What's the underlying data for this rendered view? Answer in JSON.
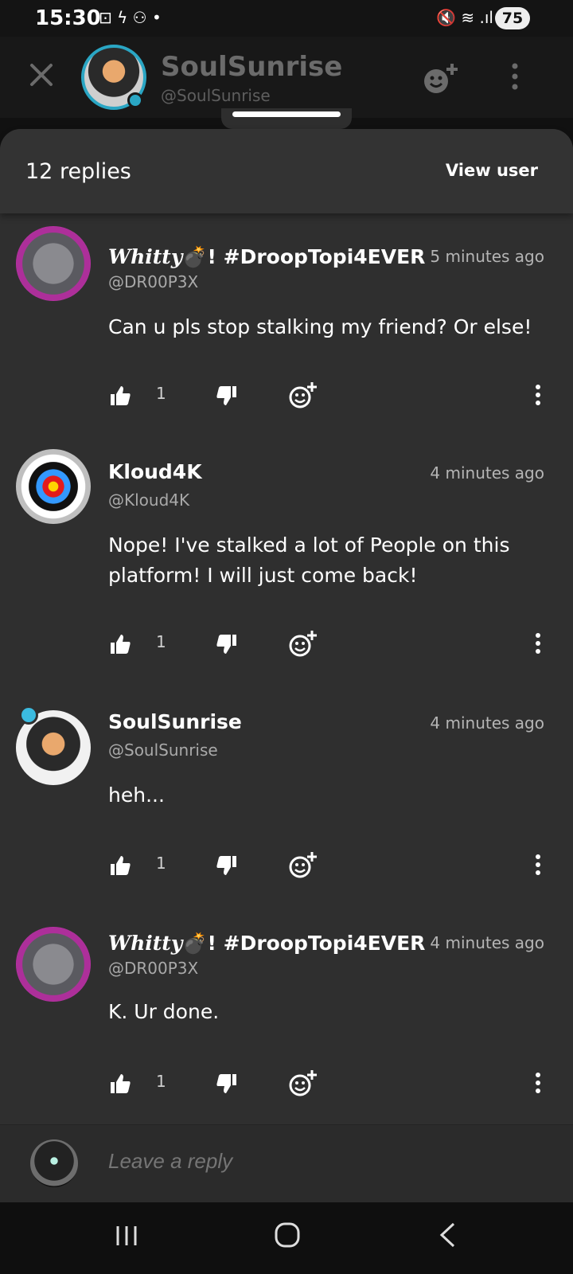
{
  "status_bar": {
    "time": "15:30",
    "left_icons": "⊡ ϟ ⚇ •",
    "right_icons": "🔇 ≋ .ıl",
    "battery": "75"
  },
  "profile_header": {
    "name": "SoulSunrise",
    "handle": "@SoulSunrise"
  },
  "sheet": {
    "replies_count": "12 replies",
    "view_user": "View user"
  },
  "comments": [
    {
      "name_script": "Whitty",
      "name_emoji": "💣",
      "name_rest": "! #DroopTopi4EVER",
      "handle": "@DR00P3X",
      "time": "5 minutes ago",
      "text": "Can u pls stop stalking my friend? Or else!",
      "likes": "1"
    },
    {
      "name": "Kloud4K",
      "handle": "@Kloud4K",
      "time": "4 minutes ago",
      "text": "Nope! I've stalked a lot of People on this platform! I will just come back!",
      "likes": "1"
    },
    {
      "name": "SoulSunrise",
      "handle": "@SoulSunrise",
      "time": "4 minutes ago",
      "text": "heh...",
      "likes": "1"
    },
    {
      "name_script": "Whitty",
      "name_emoji": "💣",
      "name_rest": "! #DroopTopi4EVER",
      "handle": "@DR00P3X",
      "time": "4 minutes ago",
      "text": "K. Ur done.",
      "likes": "1"
    }
  ],
  "reply_bar": {
    "placeholder": "Leave a reply"
  },
  "colors": {
    "sheet_bg": "#2f2f2f",
    "accent_teal": "#2aa6c4",
    "text_muted": "#b5b5b5"
  },
  "icons": [
    "close-icon",
    "add-reaction-icon",
    "more-vertical-icon",
    "thumbs-up-icon",
    "thumbs-down-icon",
    "recent-apps-icon",
    "home-icon",
    "back-icon"
  ]
}
